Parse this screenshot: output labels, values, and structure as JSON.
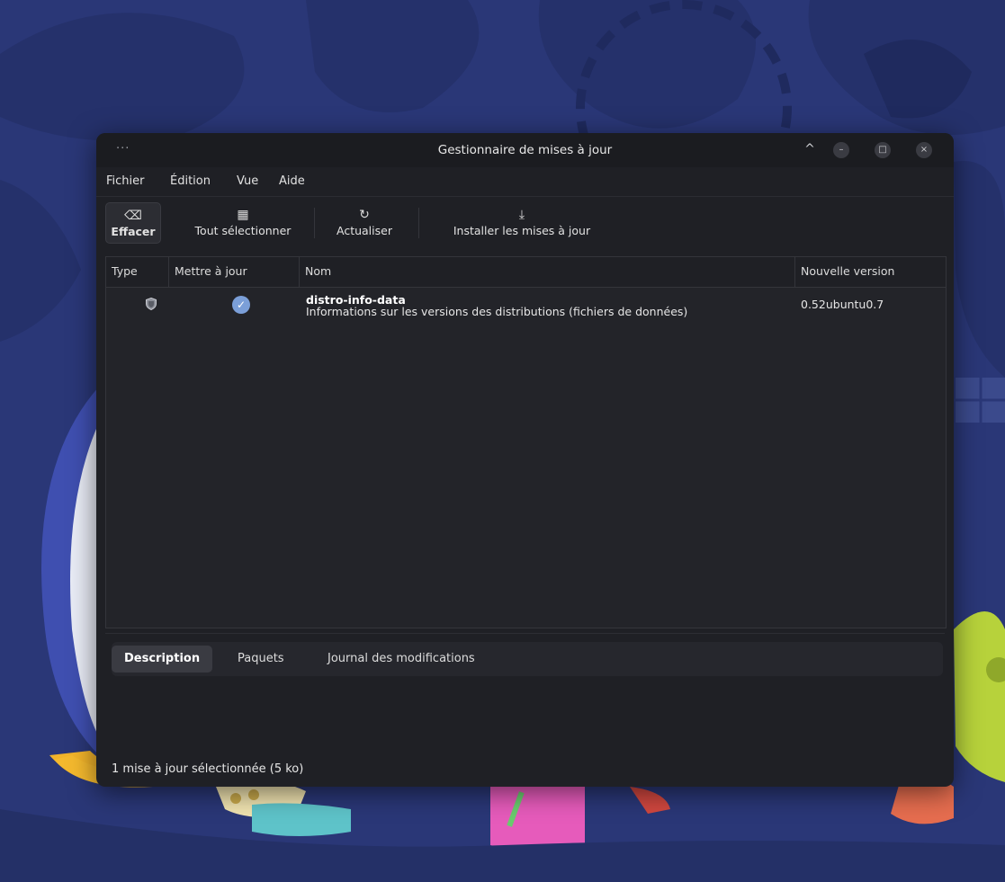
{
  "window": {
    "title": "Gestionnaire de mises à jour",
    "menu_dots": "···"
  },
  "menubar": {
    "items": [
      "Fichier",
      "Édition",
      "Vue",
      "Aide"
    ]
  },
  "toolbar": {
    "clear_label": "Effacer",
    "select_all_label": "Tout sélectionner",
    "refresh_label": "Actualiser",
    "install_label": "Installer les mises à jour"
  },
  "table": {
    "columns": [
      "Type",
      "Mettre à jour",
      "Nom",
      "Nouvelle version"
    ],
    "rows": [
      {
        "type_icon": "shield-icon",
        "selected": true,
        "name": "distro-info-data",
        "description": "Informations sur les versions des distributions (fichiers de données)",
        "version": "0.52ubuntu0.7"
      }
    ]
  },
  "details": {
    "tabs": [
      "Description",
      "Paquets",
      "Journal des modifications"
    ],
    "active_tab": "Description"
  },
  "status": {
    "text": "1 mise à jour sélectionnée (5 ko)"
  },
  "colors": {
    "desktop": "#2a3777",
    "window_bg": "#1f2025",
    "accent_check": "#7b9fd8"
  }
}
